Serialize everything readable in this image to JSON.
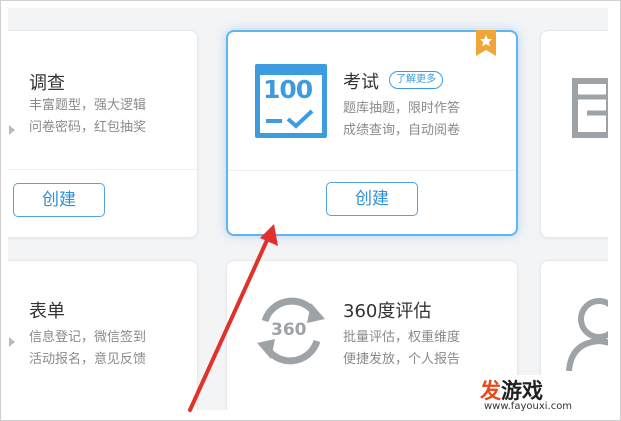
{
  "cards": {
    "survey": {
      "title": "调查",
      "desc_line1": "丰富题型，强大逻辑",
      "desc_line2": "问卷密码，红包抽奖",
      "button": "创建"
    },
    "exam": {
      "title": "考试",
      "tag": "了解更多",
      "desc_line1": "题库抽题，限时作答",
      "desc_line2": "成绩查询，自动阅卷",
      "button": "创建",
      "icon_text": "100"
    },
    "form": {
      "title": "表单",
      "desc_line1": "信息登记，微信签到",
      "desc_line2": "活动报名，意见反馈"
    },
    "evaluation": {
      "title": "360度评估",
      "desc_line1": "批量评估，权重维度",
      "desc_line2": "便捷发放，个人报告",
      "icon_text": "360"
    }
  },
  "watermark": {
    "brand_accent": "发",
    "brand_rest": "游戏",
    "url": "www.fayouxi.com"
  },
  "colors": {
    "accent": "#3d9be0",
    "ribbon": "#f0a53a",
    "arrow": "#e0312a"
  }
}
